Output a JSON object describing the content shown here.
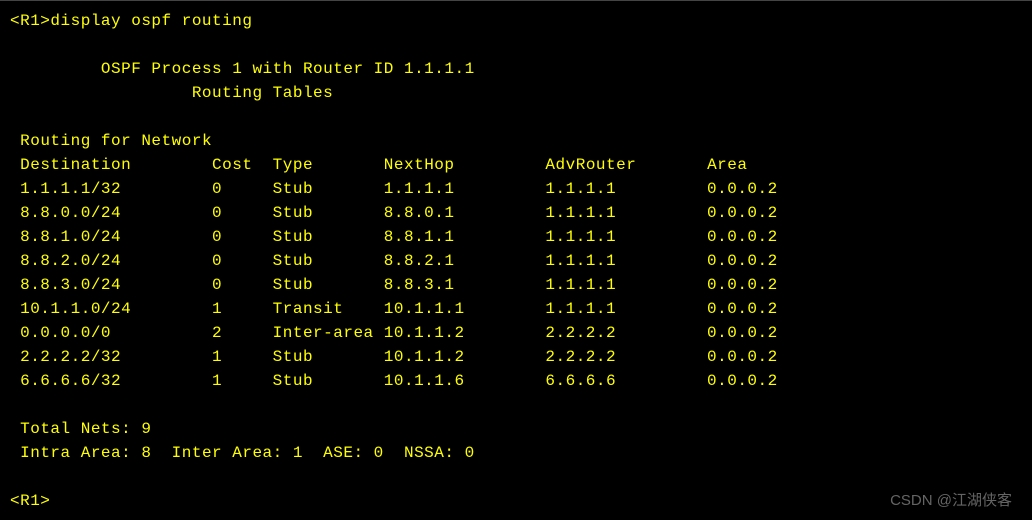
{
  "prompt": "<R1>",
  "command": "display ospf routing",
  "header1": "OSPF Process 1 with Router ID 1.1.1.1",
  "header2": "Routing Tables",
  "section_title": "Routing for Network",
  "columns": {
    "c0": "Destination",
    "c1": "Cost",
    "c2": "Type",
    "c3": "NextHop",
    "c4": "AdvRouter",
    "c5": "Area"
  },
  "rows": [
    {
      "dest": "1.1.1.1/32",
      "cost": "0",
      "type": "Stub",
      "nexthop": "1.1.1.1",
      "adv": "1.1.1.1",
      "area": "0.0.0.2"
    },
    {
      "dest": "8.8.0.0/24",
      "cost": "0",
      "type": "Stub",
      "nexthop": "8.8.0.1",
      "adv": "1.1.1.1",
      "area": "0.0.0.2"
    },
    {
      "dest": "8.8.1.0/24",
      "cost": "0",
      "type": "Stub",
      "nexthop": "8.8.1.1",
      "adv": "1.1.1.1",
      "area": "0.0.0.2"
    },
    {
      "dest": "8.8.2.0/24",
      "cost": "0",
      "type": "Stub",
      "nexthop": "8.8.2.1",
      "adv": "1.1.1.1",
      "area": "0.0.0.2"
    },
    {
      "dest": "8.8.3.0/24",
      "cost": "0",
      "type": "Stub",
      "nexthop": "8.8.3.1",
      "adv": "1.1.1.1",
      "area": "0.0.0.2"
    },
    {
      "dest": "10.1.1.0/24",
      "cost": "1",
      "type": "Transit",
      "nexthop": "10.1.1.1",
      "adv": "1.1.1.1",
      "area": "0.0.0.2"
    },
    {
      "dest": "0.0.0.0/0",
      "cost": "2",
      "type": "Inter-area",
      "nexthop": "10.1.1.2",
      "adv": "2.2.2.2",
      "area": "0.0.0.2"
    },
    {
      "dest": "2.2.2.2/32",
      "cost": "1",
      "type": "Stub",
      "nexthop": "10.1.1.2",
      "adv": "2.2.2.2",
      "area": "0.0.0.2"
    },
    {
      "dest": "6.6.6.6/32",
      "cost": "1",
      "type": "Stub",
      "nexthop": "10.1.1.6",
      "adv": "6.6.6.6",
      "area": "0.0.0.2"
    }
  ],
  "totals": {
    "total_nets": "Total Nets: 9",
    "breakdown": "Intra Area: 8  Inter Area: 1  ASE: 0  NSSA: 0"
  },
  "prompt_end": "<R1>",
  "watermark": "CSDN @江湖侠客"
}
